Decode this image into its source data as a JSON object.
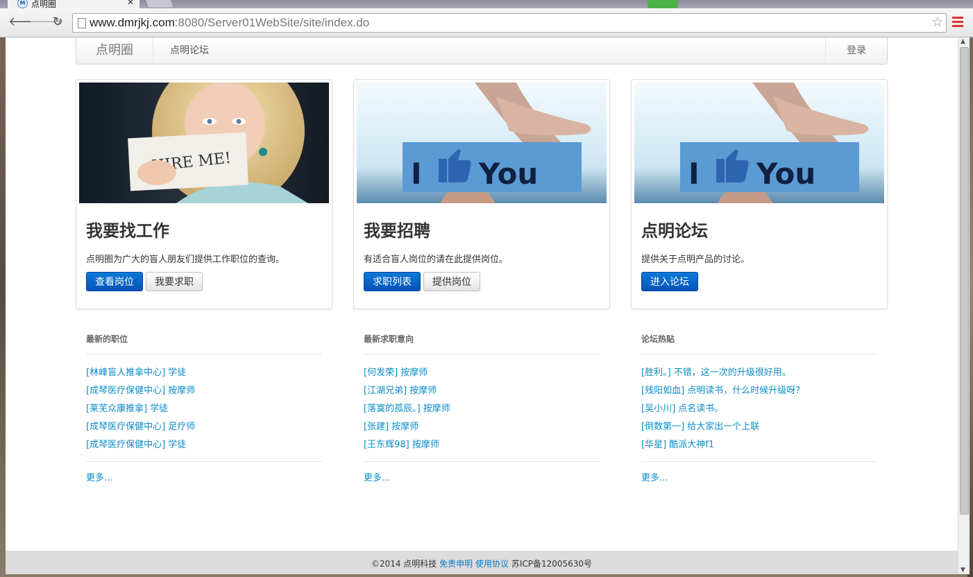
{
  "browser": {
    "tab_title": "点明圈",
    "tab_favicon": "M",
    "url_host": "www.dmrjkj.com",
    "url_rest": ":8080/Server01WebSite/site/index.do"
  },
  "navbar": {
    "brand": "点明圈",
    "forum_link": "点明论坛",
    "login": "登录"
  },
  "cards": [
    {
      "title": "我要找工作",
      "desc": "点明圈为广大的盲人朋友们提供工作职位的查询。",
      "primary_button": "查看岗位",
      "secondary_button": "我要求职",
      "image_text": "HIRE ME!"
    },
    {
      "title": "我要招聘",
      "desc": "有适合盲人岗位的请在此提供岗位。",
      "primary_button": "求职列表",
      "secondary_button": "提供岗位",
      "image_text_left": "I",
      "image_text_right": "You"
    },
    {
      "title": "点明论坛",
      "desc": "提供关于点明产品的讨论。",
      "primary_button": "进入论坛",
      "image_text_left": "I",
      "image_text_right": "You"
    }
  ],
  "lists": [
    {
      "heading": "最新的职位",
      "items": [
        "[林峰盲人推拿中心]  学徒",
        "[成琴医疗保健中心]  按摩师",
        "[莱芜众康推拿]  学徒",
        "[成琴医疗保健中心]  足疗师",
        "[成琴医疗保健中心]  学徒"
      ],
      "more": "更多..."
    },
    {
      "heading": "最新求职意向",
      "items": [
        "[何发荣]  按摩师",
        "[江湖兄弟]  按摩师",
        "[落寞的孤辰。]  按摩师",
        "[张建]  按摩师",
        "[王东辉98]  按摩师"
      ],
      "more": "更多..."
    },
    {
      "heading": "论坛热贴",
      "items": [
        "[胜利。]  不错，这一次的升级很好用。",
        "[残阳如血]  点明读书，什么时候升级呀？",
        "[吴小川]  点名读书。",
        "[倒数第一]  给大家出一个上联",
        "[华星]  酷派大神f1"
      ],
      "more": "更多..."
    }
  ],
  "footer": {
    "copyright": "©2014 点明科技",
    "disclaimer": "免责申明",
    "agreement": "使用协议",
    "icp": "苏ICP备12005630号"
  },
  "colors": {
    "primary": "#0552b8",
    "link": "#0a8cc9"
  }
}
